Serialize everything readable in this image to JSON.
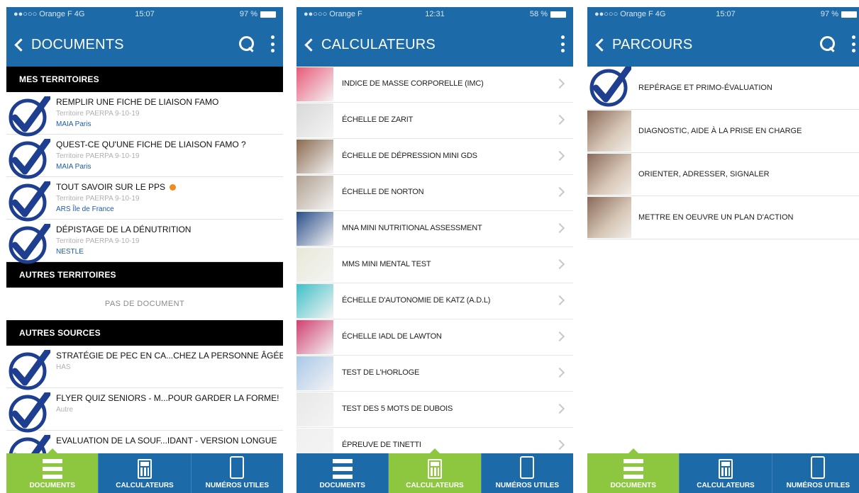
{
  "phone1": {
    "status": {
      "carrier": "●●○○○ Orange F  4G",
      "time": "15:07",
      "battery": "97 %"
    },
    "nav": {
      "back_label": "DOCUMENTS"
    },
    "sections": {
      "mes_territoires": "MES TERRITOIRES",
      "autres_territoires": "AUTRES TERRITOIRES",
      "autres_sources": "AUTRES SOURCES"
    },
    "empty_text": "PAS DE DOCUMENT",
    "docs": [
      {
        "title": "REMPLIR UNE FICHE DE LIAISON FAMO",
        "sub": "Territoire PAERPA 9-10-19",
        "src": "MAIA Paris"
      },
      {
        "title": "QUEST-CE QU'UNE FICHE DE LIAISON FAMO ?",
        "sub": "Territoire PAERPA 9-10-19",
        "src": "MAIA Paris"
      },
      {
        "title": "TOUT SAVOIR SUR LE PPS",
        "sub": "Territoire PAERPA 9-10-19",
        "src": "ARS Île de France"
      },
      {
        "title": "DÉPISTAGE DE LA DÉNUTRITION",
        "sub": "Territoire PAERPA 9-10-19",
        "src": "NESTLE"
      }
    ],
    "other_docs": [
      {
        "title": "STRATÉGIE DE PEC EN CA...CHEZ LA PERSONNE ÂGÉE",
        "sub": "HAS"
      },
      {
        "title": "FLYER QUIZ SENIORS - M...POUR GARDER LA FORME!",
        "sub": "Autre"
      },
      {
        "title": "EVALUATION DE LA SOUF...IDANT - VERSION LONGUE",
        "sub": ""
      }
    ]
  },
  "phone2": {
    "status": {
      "carrier": "●●○○○ Orange F",
      "time": "12:31",
      "battery": "58 %"
    },
    "nav": {
      "back_label": "CALCULATEURS"
    },
    "items": [
      "INDICE DE MASSE CORPORELLE (IMC)",
      "ÉCHELLE DE ZARIT",
      "ÉCHELLE DE DÉPRESSION MINI GDS",
      "ÉCHELLE DE NORTON",
      "MNA MINI NUTRITIONAL ASSESSMENT",
      "MMS MINI MENTAL TEST",
      "ÉCHELLE D'AUTONOMIE DE KATZ (A.D.L)",
      "ÉCHELLE IADL DE LAWTON",
      "TEST DE L'HORLOGE",
      "TEST DES 5 MOTS DE DUBOIS",
      "ÉPREUVE DE TINETTI"
    ],
    "thumb_colors": [
      "#e85a7a",
      "#d8d8d8",
      "#8a6a50",
      "#b0a090",
      "#2a4e8a",
      "#e8e8d8",
      "#3ec0c8",
      "#d04070",
      "#a8c8e8",
      "#e8e8e8",
      "#f0f0f0"
    ]
  },
  "phone3": {
    "status": {
      "carrier": "●●○○○ Orange F  4G",
      "time": "15:07",
      "battery": "97 %"
    },
    "nav": {
      "back_label": "PARCOURS"
    },
    "items": [
      "REPÉRAGE ET PRIMO-ÉVALUATION",
      "DIAGNOSTIC, AIDE À LA PRISE EN CHARGE",
      "ORIENTER, ADRESSER, SIGNALER",
      "METTRE EN OEUVRE UN PLAN D'ACTION"
    ]
  },
  "tabs": {
    "documents": "DOCUMENTS",
    "calculateurs": "CALCULATEURS",
    "numeros": "NUMÉROS UTILES"
  },
  "colors": {
    "primary": "#1c6aa8",
    "active_tab": "#8dc63f",
    "check": "#1e3f8f",
    "dot": "#f28a1e"
  },
  "icons": [
    "back-chevron-icon",
    "search-icon",
    "more-vertical-icon",
    "check-circle-icon",
    "chevron-right-icon",
    "menu-icon",
    "calculator-icon",
    "phone-icon"
  ]
}
